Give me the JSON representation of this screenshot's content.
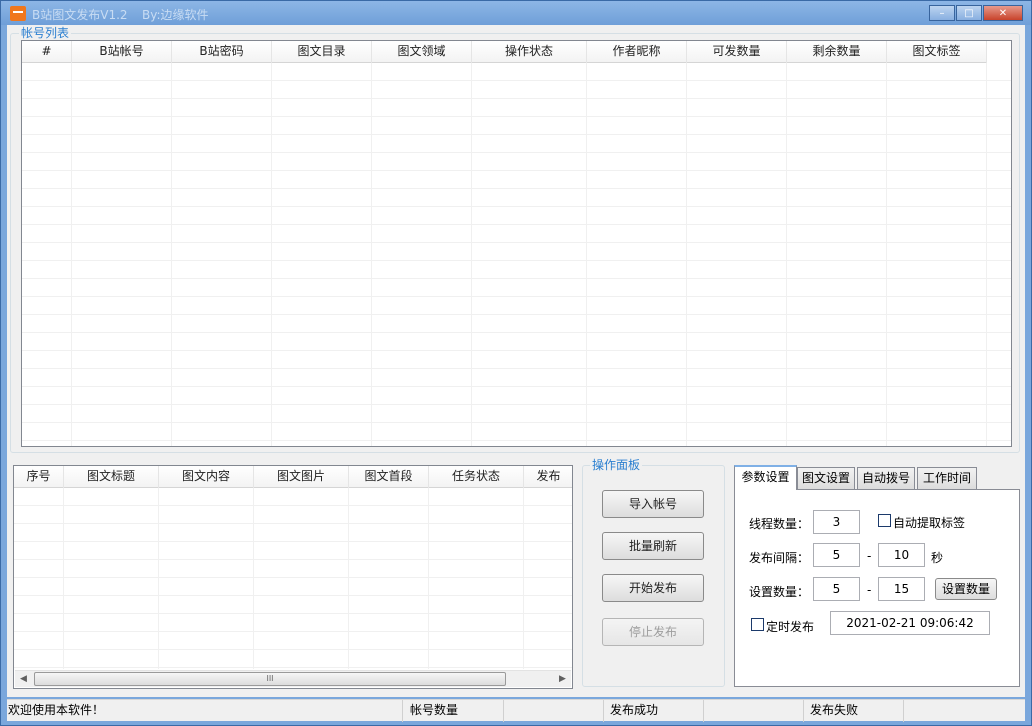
{
  "window": {
    "title": "B站图文发布V1.2",
    "author": "By:边缘软件",
    "min_glyph": "–",
    "max_glyph": "□",
    "close_glyph": "✕"
  },
  "account_group": {
    "title": "帐号列表",
    "columns": [
      "#",
      "B站帐号",
      "B站密码",
      "图文目录",
      "图文领域",
      "操作状态",
      "作者昵称",
      "可发数量",
      "剩余数量",
      "图文标签"
    ]
  },
  "task_table": {
    "columns": [
      "序号",
      "图文标题",
      "图文内容",
      "图文图片",
      "图文首段",
      "任务状态",
      "发布"
    ],
    "scroll_grip": "III"
  },
  "ops_panel": {
    "title": "操作面板",
    "import_label": "导入帐号",
    "refresh_label": "批量刷新",
    "start_label": "开始发布",
    "stop_label": "停止发布"
  },
  "tabs": [
    "参数设置",
    "图文设置",
    "自动拨号",
    "工作时间"
  ],
  "params": {
    "thread_label": "线程数量：",
    "thread_value": "3",
    "auto_tag_label": "自动提取标签",
    "interval_label": "发布间隔：",
    "interval_min": "5",
    "interval_max": "10",
    "interval_unit": "秒",
    "count_label": "设置数量：",
    "count_min": "5",
    "count_max": "15",
    "set_count_button": "设置数量",
    "dash": "-",
    "scheduled_label": "定时发布",
    "scheduled_time": "2021-02-21 09:06:42"
  },
  "status": {
    "welcome": "欢迎使用本软件！",
    "account_count_label": "帐号数量",
    "success_label": "发布成功",
    "fail_label": "发布失败"
  }
}
